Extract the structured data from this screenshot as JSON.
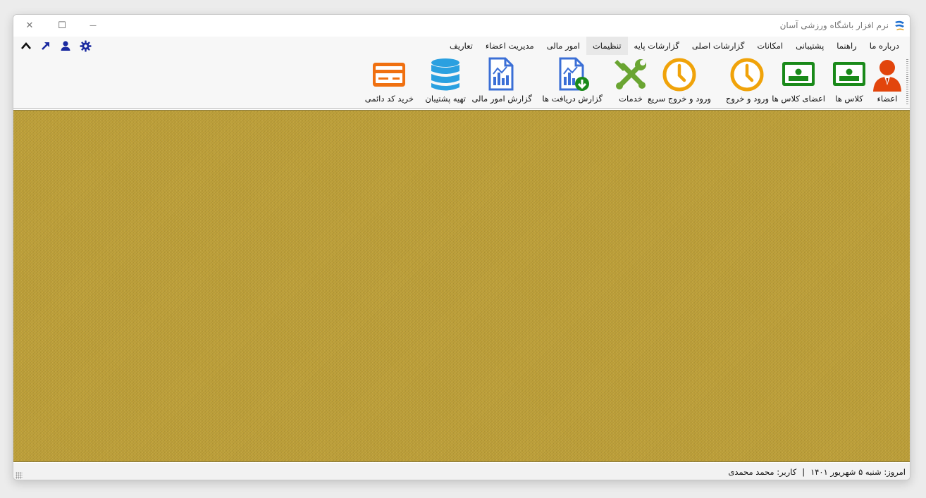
{
  "window": {
    "title": "نرم افزار باشگاه ورزشی آسان",
    "controls": {
      "minimize": "—",
      "maximize": "☐",
      "close": "✕"
    }
  },
  "menubar": {
    "items": [
      {
        "label": "تعاریف"
      },
      {
        "label": "مدیریت اعضاء"
      },
      {
        "label": "امور مالی"
      },
      {
        "label": "تنظیمات"
      },
      {
        "label": "گزارشات پایه"
      },
      {
        "label": "گزارشات اصلی"
      },
      {
        "label": "امکانات"
      },
      {
        "label": "پشتیبانی"
      },
      {
        "label": "راهنما"
      },
      {
        "label": "درباره ما"
      }
    ],
    "left_icons": [
      "gear-icon",
      "user-icon",
      "arrow-up-right-icon",
      "chevron-up-icon"
    ]
  },
  "toolbar": {
    "buttons": [
      {
        "label": "اعضاء",
        "icon": "person-icon"
      },
      {
        "label": "کلاس ها",
        "icon": "class-icon"
      },
      {
        "label": "اعضای کلاس ها",
        "icon": "class-members-icon"
      },
      {
        "label": "ورود و خروج",
        "icon": "clock-icon"
      },
      {
        "label": "ورود و خروج سریع",
        "icon": "quick-clock-icon"
      },
      {
        "label": "خدمات",
        "icon": "tools-icon"
      },
      {
        "label": "گزارش دریافت ها",
        "icon": "report-download-icon"
      },
      {
        "label": "گزارش امور مالی",
        "icon": "report-icon"
      },
      {
        "label": "تهیه پشتیبان",
        "icon": "database-icon"
      },
      {
        "label": "خرید کد دائمی",
        "icon": "credit-card-icon"
      }
    ]
  },
  "colors": {
    "main_background": "#c0a23a",
    "person": "#e2450c",
    "green": "#1a8a1a",
    "clock": "#f0a30a",
    "tools": "#6aa532",
    "report": "#3b6fd6",
    "database": "#2aa0e0",
    "card": "#f07010",
    "menu_icons": "#1a2aa0"
  },
  "statusbar": {
    "today": "امروز: شنبه ۵ شهریور ۱۴۰۱",
    "separator": "|",
    "user": "کاربر: محمد محمدی"
  }
}
